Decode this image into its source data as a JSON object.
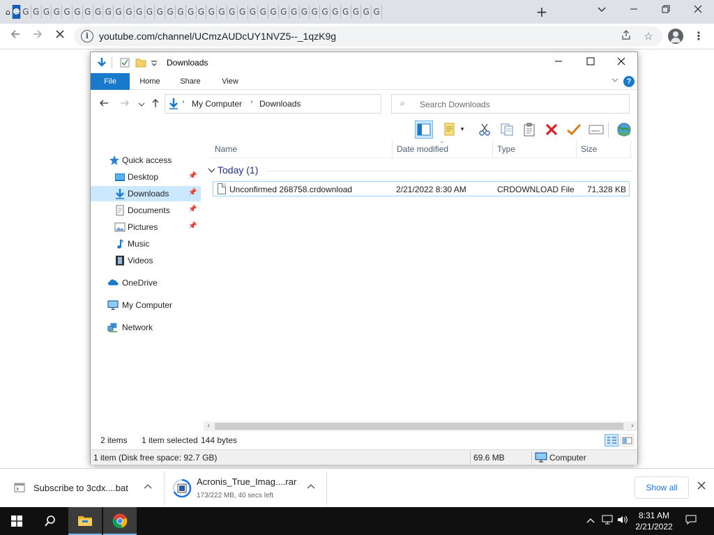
{
  "browser": {
    "tab_count": 37,
    "address_url": "youtube.com/channel/UCmzAUDcUY1NVZ5--_1qzK9g",
    "tab_favicon_glyph": "G",
    "new_tab_glyph": "+"
  },
  "explorer": {
    "title": "Downloads",
    "ribbon_tabs": [
      "File",
      "Home",
      "Share",
      "View"
    ],
    "breadcrumb": [
      "My Computer",
      "Downloads"
    ],
    "search_placeholder": "Search Downloads",
    "nav": {
      "quick_access": "Quick access",
      "desktop": "Desktop",
      "downloads": "Downloads",
      "documents": "Documents",
      "pictures": "Pictures",
      "music": "Music",
      "videos": "Videos",
      "onedrive": "OneDrive",
      "my_computer": "My Computer",
      "network": "Network"
    },
    "columns": {
      "name": "Name",
      "date_modified": "Date modified",
      "type": "Type",
      "size": "Size"
    },
    "group_label": "Today (1)",
    "files": [
      {
        "name": "Unconfirmed 268758.crdownload",
        "date_modified": "2/21/2022 8:30 AM",
        "type": "CRDOWNLOAD File",
        "size": "71,328 KB"
      }
    ],
    "status": {
      "items": "2 items",
      "selected": "1 item selected",
      "selected_size": "144 bytes",
      "disk_info": "1 item (Disk free space: 92.7 GB)",
      "size_total": "69.6 MB",
      "location": "Computer"
    }
  },
  "downloads_shelf": {
    "items": [
      {
        "name": "Subscribe to 3cdx....bat",
        "sub": ""
      },
      {
        "name": "Acronis_True_Imag....rar",
        "sub": "173/222 MB, 40 secs left"
      }
    ],
    "show_all": "Show all"
  },
  "taskbar": {
    "time": "8:31 AM",
    "date": "2/21/2022"
  },
  "colors": {
    "accent": "#1979ca",
    "selection": "#cce8ff",
    "taskbar": "#101010"
  }
}
